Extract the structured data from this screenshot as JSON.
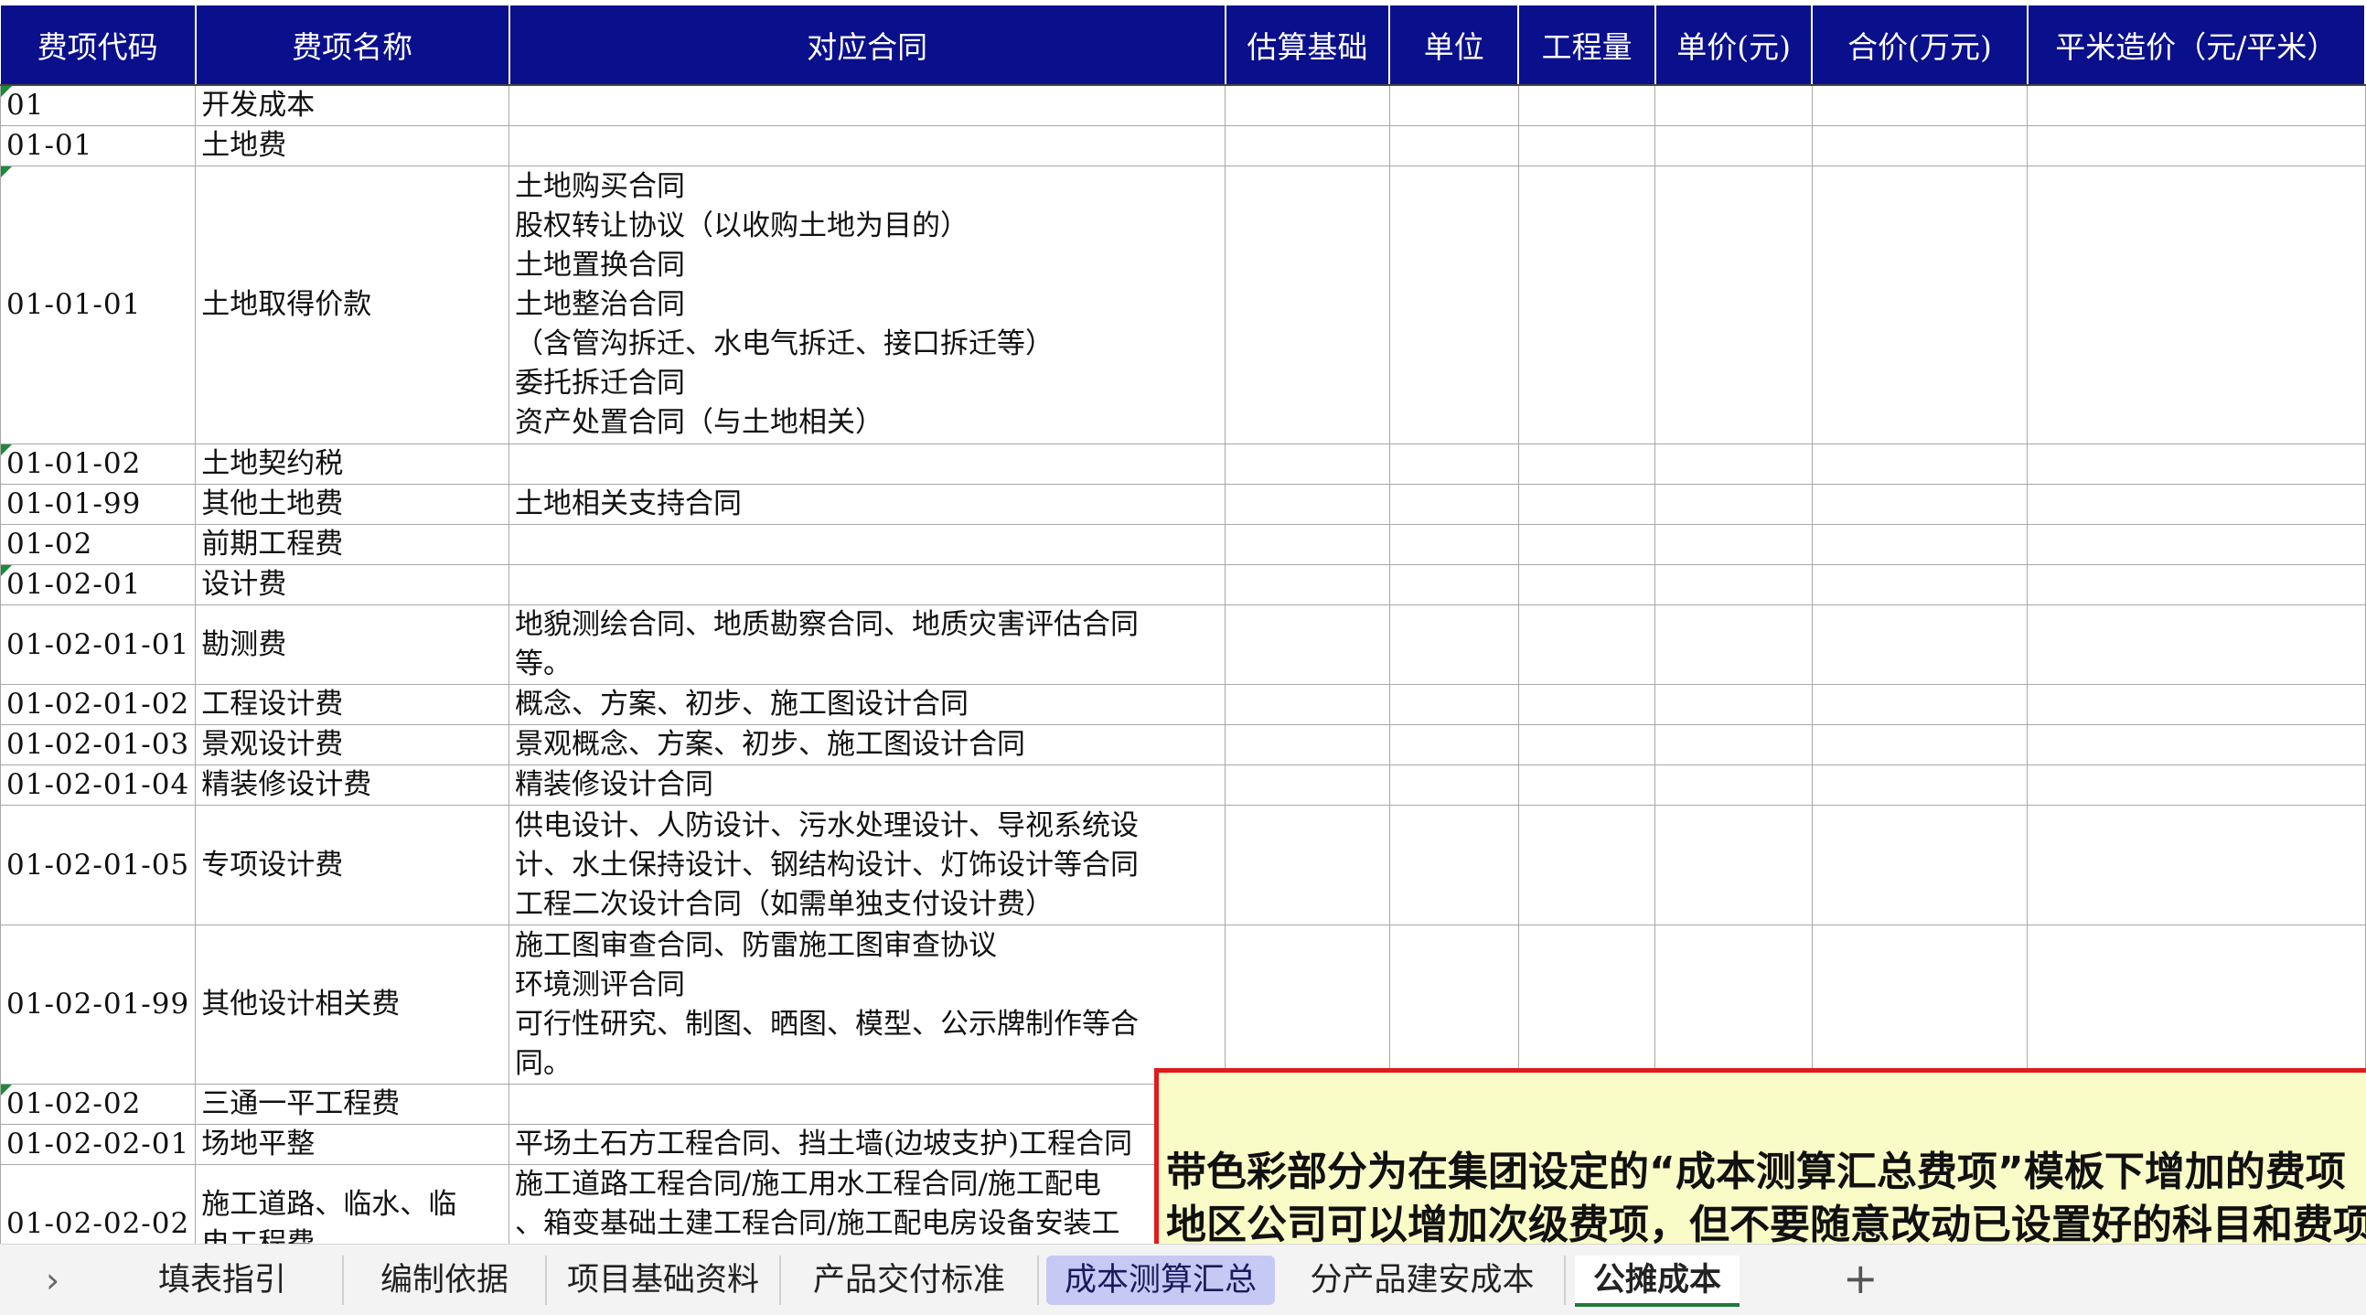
{
  "headers": [
    "费项代码",
    "费项名称",
    "对应合同",
    "估算基础",
    "单位",
    "工程量",
    "单价(元)",
    "合价(万元)",
    "平米造价（元/平米）"
  ],
  "rows": [
    {
      "code": "01",
      "name": "开发成本",
      "contract": "",
      "marked": true
    },
    {
      "code": "01-01",
      "name": "土地费",
      "contract": "",
      "marked": false
    },
    {
      "code": "01-01-01",
      "name": "土地取得价款",
      "contract": "土地购买合同\n股权转让协议（以收购土地为目的）\n土地置换合同\n土地整治合同\n（含管沟拆迁、水电气拆迁、接口拆迁等）\n委托拆迁合同\n资产处置合同（与土地相关）",
      "marked": true
    },
    {
      "code": "01-01-02",
      "name": "土地契约税",
      "contract": "",
      "marked": true
    },
    {
      "code": "01-01-99",
      "name": "其他土地费",
      "contract": "土地相关支持合同",
      "marked": false
    },
    {
      "code": "01-02",
      "name": "前期工程费",
      "contract": "",
      "marked": false
    },
    {
      "code": "01-02-01",
      "name": "设计费",
      "contract": "",
      "marked": true
    },
    {
      "code": "01-02-01-01",
      "name": "勘测费",
      "contract": "地貌测绘合同、地质勘察合同、地质灾害评估合同\n等。",
      "marked": false
    },
    {
      "code": "01-02-01-02",
      "name": "工程设计费",
      "contract": "概念、方案、初步、施工图设计合同",
      "marked": false
    },
    {
      "code": "01-02-01-03",
      "name": "景观设计费",
      "contract": "景观概念、方案、初步、施工图设计合同",
      "marked": false
    },
    {
      "code": "01-02-01-04",
      "name": "精装修设计费",
      "contract": "精装修设计合同",
      "marked": false
    },
    {
      "code": "01-02-01-05",
      "name": "专项设计费",
      "contract": "供电设计、人防设计、污水处理设计、导视系统设\n计、水土保持设计、钢结构设计、灯饰设计等合同\n工程二次设计合同（如需单独支付设计费）",
      "marked": false
    },
    {
      "code": "01-02-01-99",
      "name": "其他设计相关费",
      "contract": "施工图审查合同、防雷施工图审查协议\n环境测评合同\n可行性研究、制图、晒图、模型、公示牌制作等合\n同。",
      "marked": false
    },
    {
      "code": "01-02-02",
      "name": "三通一平工程费",
      "contract": "",
      "marked": true
    },
    {
      "code": "01-02-02-01",
      "name": "场地平整",
      "contract": "平场土石方工程合同、挡土墙(边坡支护)工程合同",
      "marked": false
    },
    {
      "code": "01-02-02-02",
      "name": "施工道路、临水、临\n电工程费",
      "contract": "施工道路工程合同/施工用水工程合同/施工配电\n、箱变基础土建工程合同/施工配电房设备安装工\n程合同/施工用电线路架设合同",
      "marked": false
    }
  ],
  "note": {
    "line1": "带色彩部分为在集团设定的“成本测算汇总费项”模板下增加的费项",
    "line2": "地区公司可以增加次级费项，但不要随意改动已设置好的科目和费项"
  },
  "tabs": {
    "nav": "›",
    "items": [
      "填表指引",
      "编制依据",
      "项目基础资料",
      "产品交付标准",
      "成本测算汇总",
      "分产品建安成本",
      "公摊成本"
    ],
    "add": "+"
  },
  "colors": {
    "header_bg": "#0a0f8c",
    "note_bg": "#fafcc8",
    "note_border": "#e01b1b",
    "tab_highlight": "#c7c9f5",
    "active_tab_underline": "#1e7a3a",
    "marker": "#1e8a3a"
  }
}
